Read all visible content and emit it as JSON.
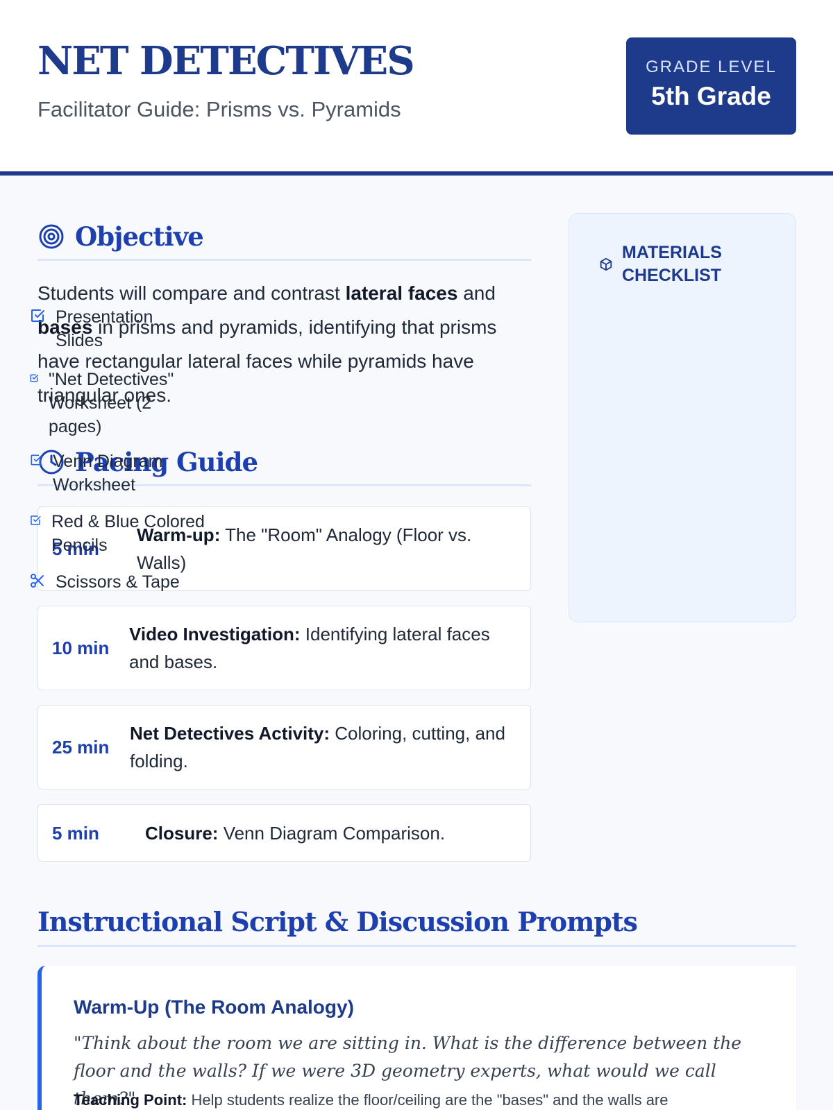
{
  "header": {
    "title": "NET DETECTIVES",
    "subtitle": "Facilitator Guide: Prisms vs. Pyramids",
    "grade_label": "GRADE LEVEL",
    "grade_value": "5th Grade"
  },
  "objective": {
    "heading": "Objective",
    "icon": "target-icon",
    "text_1": "Students will compare and contrast ",
    "bold_1": "lateral faces",
    "text_2": " and ",
    "bold_2": "bases",
    "text_3": " in prisms and pyramids, identifying that prisms have rectangular lateral faces while pyramids have triangular ones."
  },
  "pacing": {
    "heading": "Pacing Guide",
    "icon": "clock-icon",
    "items": [
      {
        "time": "5 min",
        "label": "Warm-up:",
        "desc": " The \"Room\" Analogy (Floor vs. Walls)"
      },
      {
        "time": "10 min",
        "label": "Video Investigation:",
        "desc": " Identifying lateral faces and bases."
      },
      {
        "time": "25 min",
        "label": "Net Detectives Activity:",
        "desc": " Coloring, cutting, and folding."
      },
      {
        "time": "5 min",
        "label": "Closure:",
        "desc": " Venn Diagram Comparison."
      }
    ]
  },
  "materials": {
    "heading": "MATERIALS CHECKLIST",
    "icon": "cube-icon",
    "items": [
      {
        "label": "Presentation Slides",
        "icon": "checkbox-icon"
      },
      {
        "label": "\"Net Detectives\" Worksheet (2 pages)",
        "icon": "checkbox-icon"
      },
      {
        "label": "Venn Diagram Worksheet",
        "icon": "checkbox-icon"
      },
      {
        "label": "Red & Blue Colored Pencils",
        "icon": "checkbox-icon"
      },
      {
        "label": "Scissors & Tape",
        "icon": "scissors-icon"
      }
    ]
  },
  "script": {
    "heading": "Instructional Script & Discussion Prompts",
    "card_title": "Warm-Up (The Room Analogy)",
    "quote": "\"Think about the room we are sitting in. What is the difference between the floor and the walls? If we were 3D geometry experts, what would we call them?\"",
    "point_label": "Teaching Point:",
    "point_text": " Help students realize the floor/ceiling are the \"bases\" and the walls are"
  },
  "colors": {
    "primary": "#1e3a8a",
    "accent": "#2563eb",
    "background": "#f7f9fc",
    "panel": "#eef4fe"
  }
}
